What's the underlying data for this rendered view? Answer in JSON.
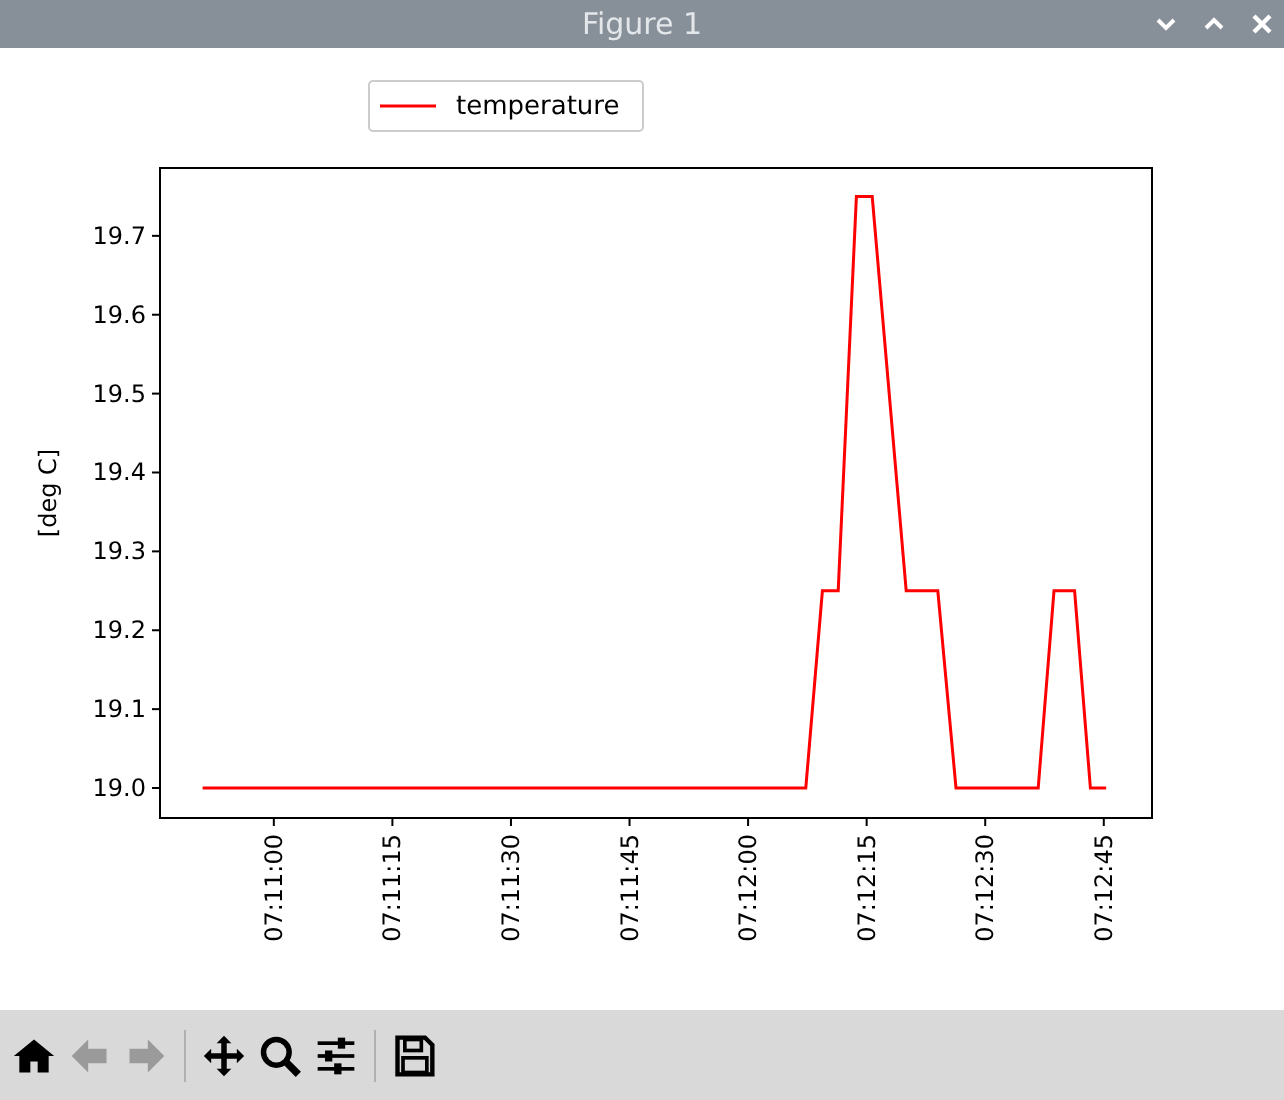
{
  "window": {
    "title": "Figure 1"
  },
  "figure": {
    "chart_data": {
      "type": "line",
      "ylabel": "[deg C]",
      "x": [
        25851,
        25927.3,
        25929.4,
        25931.4,
        25933.7,
        25935.7,
        25940,
        25944,
        25946.3,
        25956.7,
        25958.7,
        25961.3,
        25963.3,
        25965.3
      ],
      "series": [
        {
          "name": "temperature",
          "color": "#ff0000",
          "values": [
            19.0,
            19.0,
            19.25,
            19.25,
            19.75,
            19.75,
            19.25,
            19.25,
            19.0,
            19.0,
            19.25,
            19.25,
            19.0,
            19.0
          ]
        }
      ],
      "xlim": [
        25845.6,
        25971.1
      ],
      "ylim": [
        18.962,
        19.786
      ],
      "xticks": [
        {
          "value": 25860,
          "label": "07:11:00"
        },
        {
          "value": 25875,
          "label": "07:11:15"
        },
        {
          "value": 25890,
          "label": "07:11:30"
        },
        {
          "value": 25905,
          "label": "07:11:45"
        },
        {
          "value": 25920,
          "label": "07:12:00"
        },
        {
          "value": 25935,
          "label": "07:12:15"
        },
        {
          "value": 25950,
          "label": "07:12:30"
        },
        {
          "value": 25965,
          "label": "07:12:45"
        }
      ],
      "yticks": [
        {
          "value": 19.0,
          "label": "19.0"
        },
        {
          "value": 19.1,
          "label": "19.1"
        },
        {
          "value": 19.2,
          "label": "19.2"
        },
        {
          "value": 19.3,
          "label": "19.3"
        },
        {
          "value": 19.4,
          "label": "19.4"
        },
        {
          "value": 19.5,
          "label": "19.5"
        },
        {
          "value": 19.6,
          "label": "19.6"
        },
        {
          "value": 19.7,
          "label": "19.7"
        }
      ]
    }
  },
  "toolbar": [
    {
      "kind": "home",
      "disabled": false
    },
    {
      "kind": "back",
      "disabled": true
    },
    {
      "kind": "forward",
      "disabled": true
    },
    {
      "kind": "separator"
    },
    {
      "kind": "pan",
      "disabled": false
    },
    {
      "kind": "zoom",
      "disabled": false
    },
    {
      "kind": "configure",
      "disabled": false
    },
    {
      "kind": "separator"
    },
    {
      "kind": "save",
      "disabled": false
    }
  ]
}
